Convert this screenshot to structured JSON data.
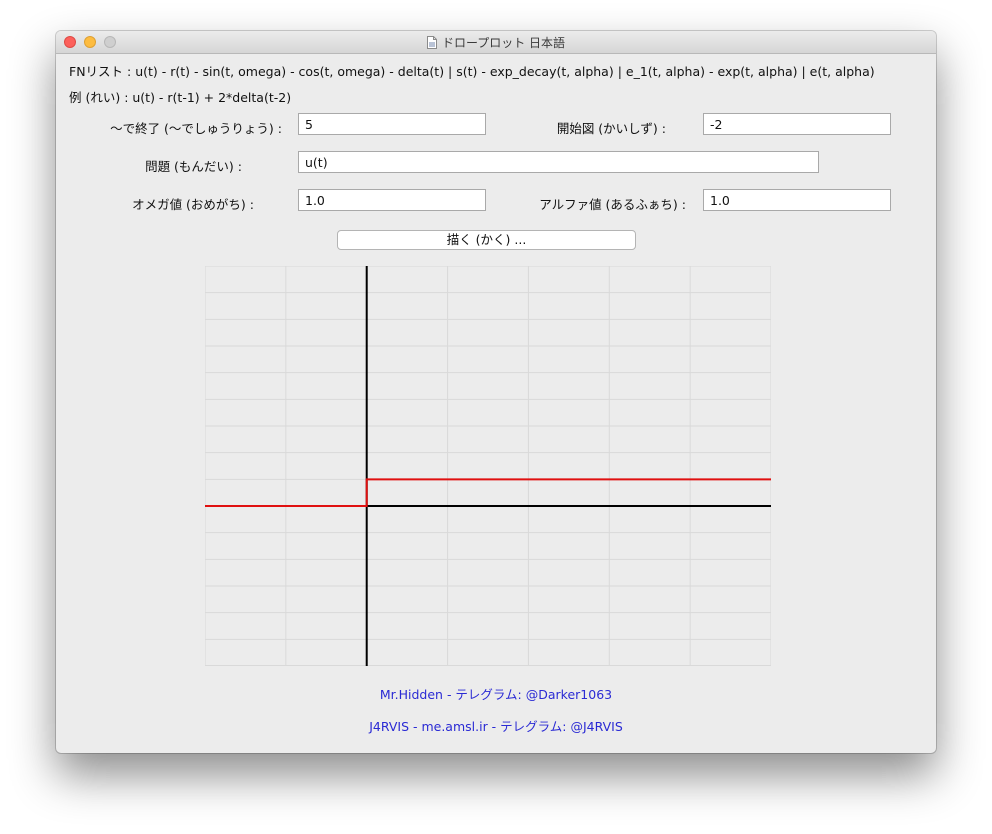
{
  "window": {
    "title": "ドロープロット 日本語"
  },
  "info": {
    "fn_list": "FNリスト : u(t) - r(t) - sin(t, omega) - cos(t, omega) - delta(t) | s(t) - exp_decay(t, alpha) | e_1(t, alpha) - exp(t, alpha) | e(t, alpha)",
    "example": "例 (れい) : u(t) - r(t-1) + 2*delta(t-2)"
  },
  "form": {
    "end_label": "〜で終了 (〜でしゅうりょう) :",
    "end_value": "5",
    "start_label": "開始図 (かいしず) :",
    "start_value": "-2",
    "problem_label": "問題 (もんだい) :",
    "problem_value": "u(t)",
    "omega_label": "オメガ値 (おめがち) :",
    "omega_value": "1.0",
    "alpha_label": "アルファ値 (あるふぁち) :",
    "alpha_value": "1.0",
    "draw_button": "描く (かく) ..."
  },
  "chart_data": {
    "type": "line",
    "function": "u(t)",
    "series": [
      {
        "x": [
          -2,
          0,
          0,
          5
        ],
        "y": [
          0,
          0,
          1,
          1
        ],
        "color": "#e01010"
      }
    ],
    "xlim": [
      -2,
      5
    ],
    "ylim": [
      -6,
      9
    ],
    "grid": true,
    "axis_color": "#000000",
    "grid_color": "#d9d9d9"
  },
  "credits": {
    "line1": "Mr.Hidden - テレグラム: @Darker1063",
    "line2": "J4RVIS - me.amsl.ir - テレグラム: @J4RVIS",
    "color": "#2a2ad4"
  }
}
